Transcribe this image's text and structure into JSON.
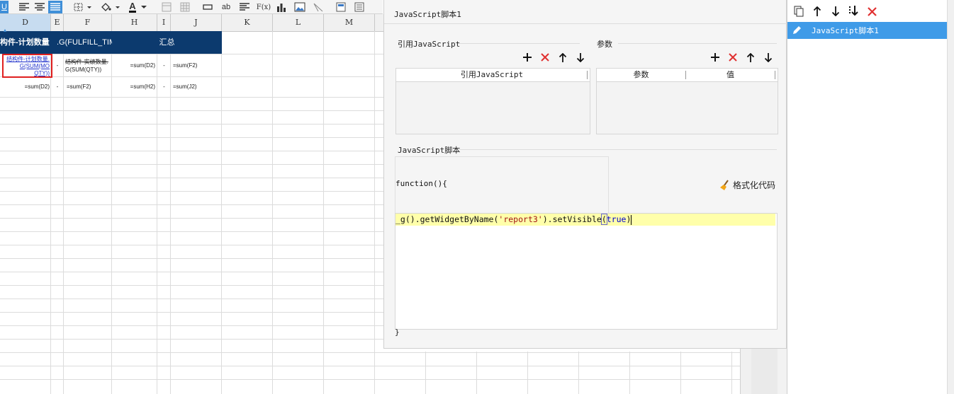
{
  "toolbar": {
    "buttons": [
      "underline",
      "align-left",
      "align-center",
      "align-justify",
      "border",
      "fill-color",
      "font-color",
      "merge",
      "table",
      "field",
      "text",
      "formula",
      "chart",
      "image",
      "slash"
    ],
    "text_ab": "ab",
    "text_fx": "F(x)",
    "font_color_glyph": "A"
  },
  "sheet": {
    "columns": [
      "D",
      "E",
      "F",
      "H",
      "I",
      "J",
      "K",
      "L",
      "M"
    ],
    "selected_column": "D",
    "header_row": {
      "col_d": "构件-计划数量",
      "col_ef": ".G(FULFILL_TIM",
      "col_hj": "汇总"
    },
    "row1": {
      "d": "结构件-计划数量.G(SUM(MOQTY))",
      "d_line1": "结构件-计划数量.",
      "d_line2": "G(SUM(MO",
      "d_line3": "QTY))",
      "e": "-",
      "f_line1": "结构件-实绩数量.",
      "f_line2": "G(SUM(QTY))",
      "h": "=sum(D2)",
      "i": "-",
      "j": "=sum(F2)"
    },
    "row2": {
      "d": "=sum(D2)",
      "e": "-",
      "f": "=sum(F2)",
      "h": "=sum(H2)",
      "i": "-",
      "j": "=sum(J2)"
    }
  },
  "dialog": {
    "title": "JavaScript脚本1",
    "section_refs": "引用JavaScript",
    "section_params": "参数",
    "refs_table_header": "引用JavaScript",
    "params_table_headers": [
      "参数",
      "值"
    ],
    "section_script": "JavaScript脚本",
    "code_function": "function(){",
    "code_line": {
      "prefix": "_g().getWidgetByName(",
      "string": "'report3'",
      "mid": ").setVisible",
      "paren": "(",
      "keyword": "true",
      "suffix": ")"
    },
    "code_close": "}",
    "format_button": "格式化代码",
    "colors": {
      "string": "#a31515",
      "keyword": "#0000cc",
      "highlight": "#ffffaa"
    }
  },
  "right_panel": {
    "toolbar_icons": [
      "copy-icon",
      "arrow-up-icon",
      "arrow-down-icon",
      "move-bottom-icon",
      "delete-icon"
    ],
    "items": [
      {
        "label": "JavaScript脚本1",
        "selected": true
      }
    ],
    "accent": "#3f9be8"
  }
}
